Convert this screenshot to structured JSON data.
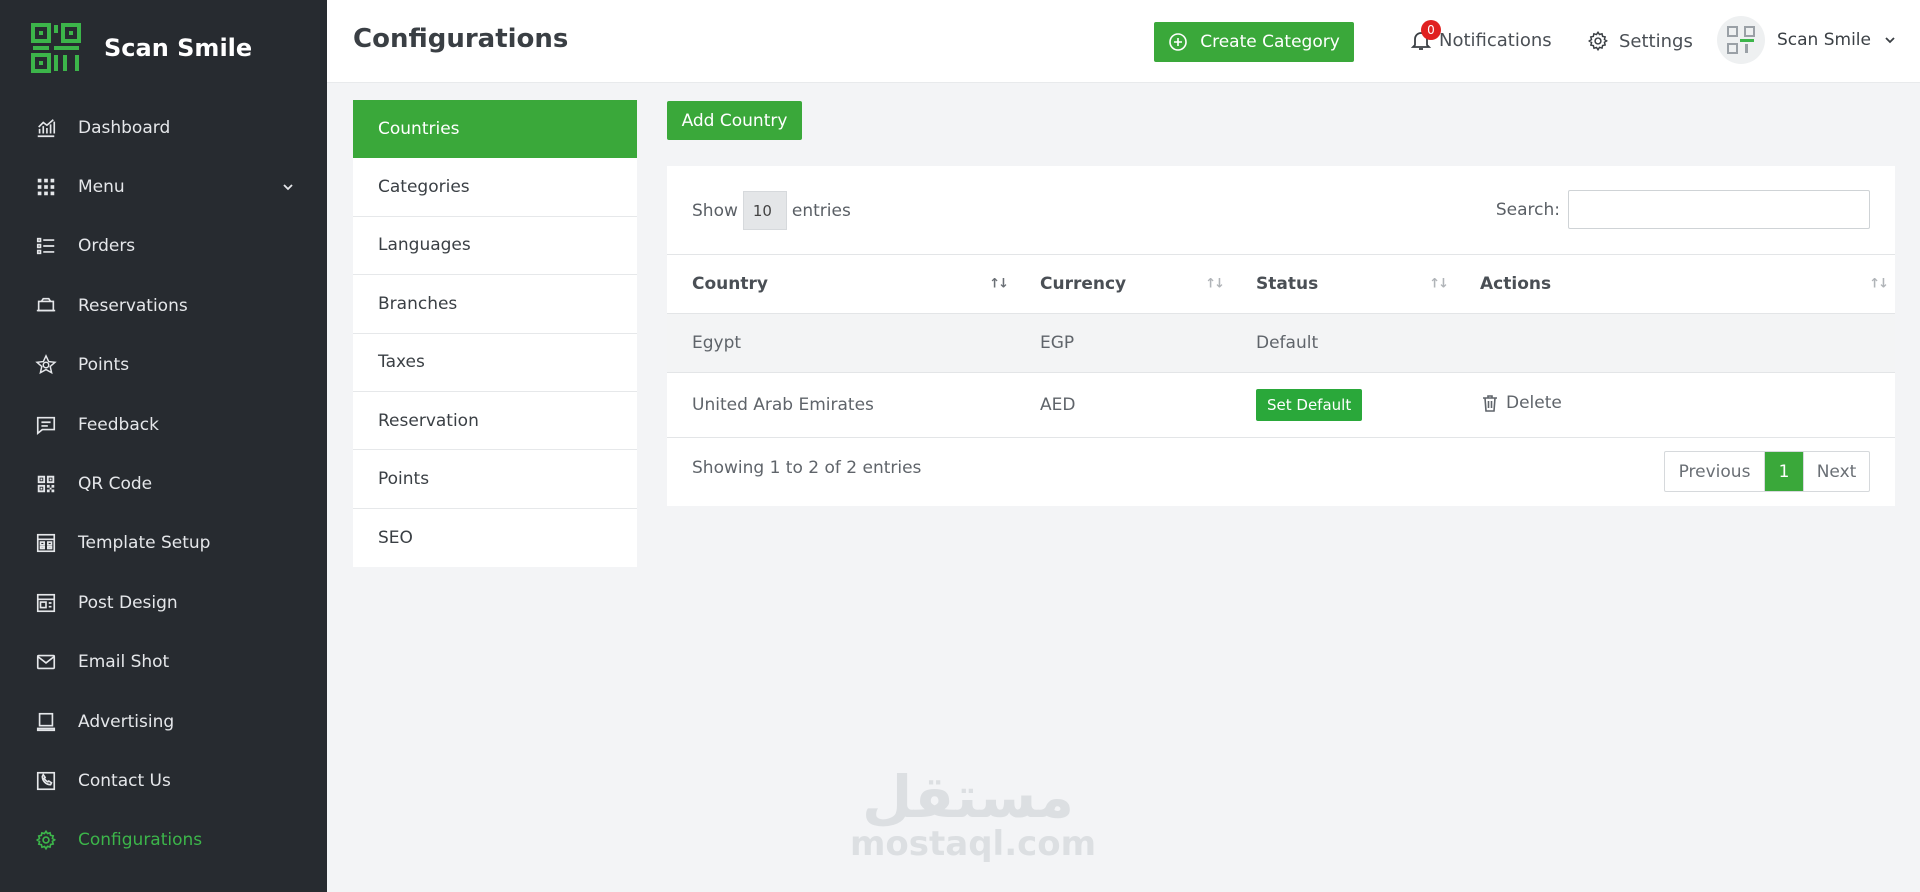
{
  "app": {
    "name": "Scan Smile"
  },
  "colors": {
    "accent": "#3aa83a",
    "sidebar_bg": "#272b30",
    "active_nav": "#3cb54a",
    "badge": "#e02020"
  },
  "sidebar": {
    "items": [
      {
        "label": "Dashboard",
        "icon": "chart-icon"
      },
      {
        "label": "Menu",
        "icon": "grid-icon",
        "has_dropdown": true
      },
      {
        "label": "Orders",
        "icon": "list-icon"
      },
      {
        "label": "Reservations",
        "icon": "ticket-icon"
      },
      {
        "label": "Points",
        "icon": "star-icon"
      },
      {
        "label": "Feedback",
        "icon": "feedback-icon"
      },
      {
        "label": "QR Code",
        "icon": "qr-icon"
      },
      {
        "label": "Template Setup",
        "icon": "template-icon"
      },
      {
        "label": "Post Design",
        "icon": "post-design-icon"
      },
      {
        "label": "Email Shot",
        "icon": "mail-icon"
      },
      {
        "label": "Advertising",
        "icon": "monitor-icon"
      },
      {
        "label": "Contact Us",
        "icon": "phone-icon"
      },
      {
        "label": "Configurations",
        "icon": "gear-icon",
        "active": true
      }
    ]
  },
  "header": {
    "title": "Configurations",
    "create_label": "Create Category",
    "notifications_label": "Notifications",
    "notifications_count": "0",
    "settings_label": "Settings",
    "user_name": "Scan Smile"
  },
  "config_menu": {
    "items": [
      "Countries",
      "Categories",
      "Languages",
      "Branches",
      "Taxes",
      "Reservation",
      "Points",
      "SEO"
    ],
    "active": "Countries"
  },
  "main": {
    "add_label": "Add Country",
    "show_label": "Show",
    "entries_value": "10",
    "entries_label": "entries",
    "search_label": "Search:",
    "columns": [
      "Country",
      "Currency",
      "Status",
      "Actions"
    ],
    "rows": [
      {
        "country": "Egypt",
        "currency": "EGP",
        "status": "Default"
      },
      {
        "country": "United Arab Emirates",
        "currency": "AED",
        "status_button": "Set Default",
        "action": "Delete"
      }
    ],
    "info": "Showing 1 to 2 of 2 entries",
    "pagination": {
      "previous": "Previous",
      "current": "1",
      "next": "Next"
    }
  },
  "watermark": {
    "arabic": "مستقل",
    "latin": "mostaql.com"
  }
}
